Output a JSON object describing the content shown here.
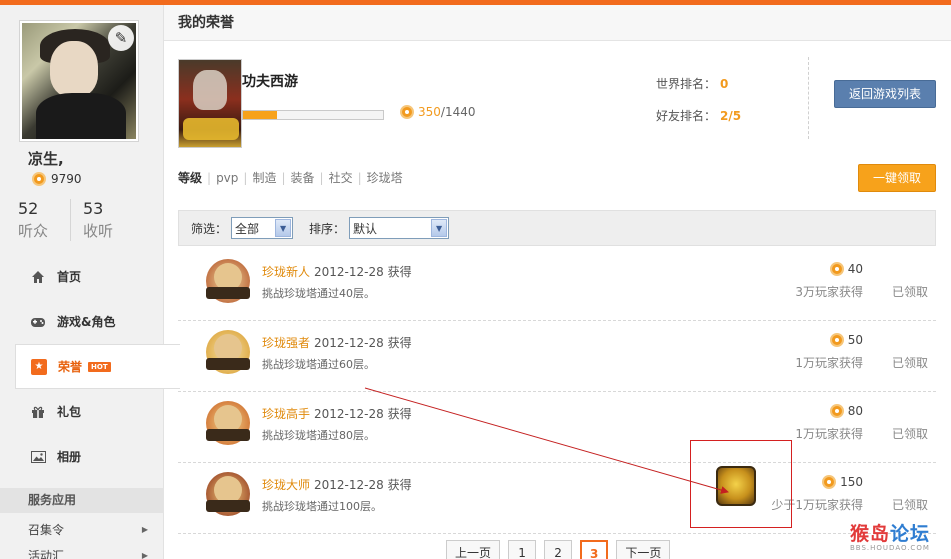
{
  "profile": {
    "username": "凉生,",
    "coins": "9790",
    "followers_count": "52",
    "followers_label": "听众",
    "following_count": "53",
    "following_label": "收听"
  },
  "sidebar": {
    "items": [
      {
        "label": "首页",
        "icon": "home-icon"
      },
      {
        "label": "游戏&角色",
        "icon": "gamepad-icon"
      },
      {
        "label": "荣誉",
        "icon": "star-icon",
        "badge": "HOT"
      },
      {
        "label": "礼包",
        "icon": "gift-icon"
      },
      {
        "label": "相册",
        "icon": "photo-icon"
      }
    ],
    "section_title": "服务应用",
    "sub_items": [
      {
        "label": "召集令"
      },
      {
        "label": "活动汇"
      }
    ]
  },
  "header": {
    "title": "我的荣誉"
  },
  "game": {
    "title": "功夫西游",
    "progress_current": "350",
    "progress_total": "/1440",
    "progress_fraction": 0.243,
    "world_rank_label": "世界排名：",
    "world_rank_value": "0",
    "friend_rank_label": "好友排名：",
    "friend_rank_value": "2/5",
    "back_button": "返回游戏列表"
  },
  "categories": [
    "等级",
    "pvp",
    "制造",
    "装备",
    "社交",
    "珍珑塔"
  ],
  "claim_all_button": "一键领取",
  "filter": {
    "filter_label": "筛选：",
    "filter_value": "全部",
    "sort_label": "排序：",
    "sort_value": "默认"
  },
  "honors": [
    {
      "name": "珍珑新人",
      "date": "2012-12-28 获得",
      "desc": "挑战珍珑塔通过40层。",
      "points": "40",
      "players": "3万玩家获得",
      "status": "已领取"
    },
    {
      "name": "珍珑强者",
      "date": "2012-12-28 获得",
      "desc": "挑战珍珑塔通过60层。",
      "points": "50",
      "players": "1万玩家获得",
      "status": "已领取"
    },
    {
      "name": "珍珑高手",
      "date": "2012-12-28 获得",
      "desc": "挑战珍珑塔通过80层。",
      "points": "80",
      "players": "1万玩家获得",
      "status": "已领取"
    },
    {
      "name": "珍珑大师",
      "date": "2012-12-28 获得",
      "desc": "挑战珍珑塔通过100层。",
      "points": "150",
      "players": "少于1万玩家获得",
      "status": "已领取"
    }
  ],
  "pager": {
    "prev": "上一页",
    "pages": [
      "1",
      "2",
      "3"
    ],
    "current": "3",
    "next": "下一页"
  },
  "watermark": {
    "brand_a": "猴岛",
    "brand_b": "论坛",
    "url": "BBS.HOUDAO.COM"
  },
  "colors": {
    "accent": "#f26b1d",
    "coin": "#f29a1e",
    "back_button": "#5a7fae",
    "annotation": "#d42020"
  }
}
